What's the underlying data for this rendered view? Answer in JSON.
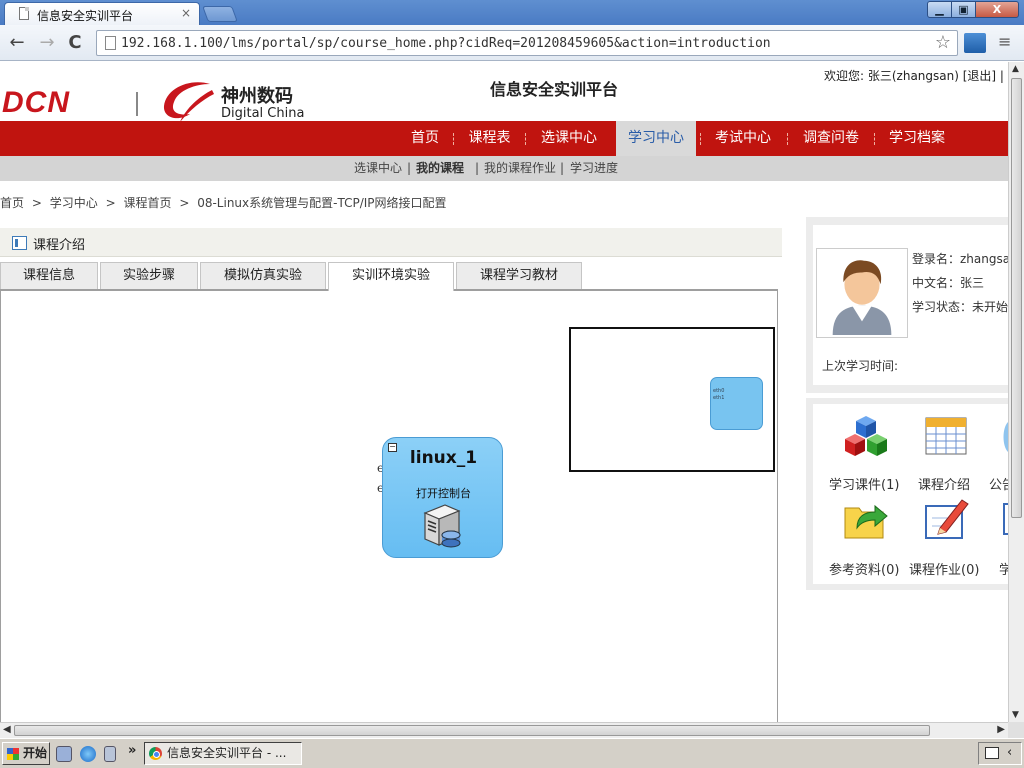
{
  "browser": {
    "tab_title": "信息安全实训平台",
    "tab_close": "×",
    "url": "192.168.1.100/lms/portal/sp/course_home.php?cidReq=201208459605&action=introduction",
    "back": "←",
    "forward": "→",
    "reload": "C",
    "star": "☆",
    "wrench": "≡",
    "win_min": "▁",
    "win_max": "▣",
    "win_close": "X"
  },
  "header": {
    "logo_dcn": "DCN",
    "logo_cn": "神州数码",
    "logo_en": "Digital China",
    "site_title": "信息安全实训平台",
    "welcome": "欢迎您: 张三(zhangsan) [退出] |"
  },
  "main_nav": {
    "items": [
      {
        "label": "首页",
        "active": false
      },
      {
        "label": "课程表",
        "active": false
      },
      {
        "label": "选课中心",
        "active": false
      },
      {
        "label": "学习中心",
        "active": true
      },
      {
        "label": "考试中心",
        "active": false
      },
      {
        "label": "调查问卷",
        "active": false
      },
      {
        "label": "学习档案",
        "active": false
      }
    ]
  },
  "sub_nav": {
    "items": [
      "选课中心",
      "|",
      "我的课程",
      "|",
      "我的课程作业",
      "|",
      "学习进度"
    ]
  },
  "breadcrumb": {
    "items": [
      "首页",
      ">",
      "学习中心",
      ">",
      "课程首页",
      ">",
      "08-Linux系统管理与配置-TCP/IP网络接口配置"
    ]
  },
  "course": {
    "panel_title": "课程介绍",
    "tabs": [
      {
        "label": "课程信息",
        "active": false
      },
      {
        "label": "实验步骤",
        "active": false
      },
      {
        "label": "模拟仿真实验",
        "active": false
      },
      {
        "label": "实训环境实验",
        "active": true
      },
      {
        "label": "课程学习教材",
        "active": false
      }
    ]
  },
  "topology": {
    "node_name": "linux_1",
    "node_action": "打开控制台",
    "ports": [
      "eth0",
      "eth1"
    ],
    "collapse_symbol": "−",
    "minimap_ports": [
      "eth0",
      "eth1"
    ]
  },
  "user": {
    "login_name": "登录名：zhangsa",
    "cn_name": "中文名：张三",
    "status": "学习状态：未开始",
    "last_time_label": "上次学习时间:"
  },
  "quick_links": [
    {
      "label": "学习课件(1)",
      "icon": "cubes-icon"
    },
    {
      "label": "课程介绍",
      "icon": "calendar-icon"
    },
    {
      "label": "公告",
      "icon": "megaphone-icon"
    },
    {
      "label": "参考资料(0)",
      "icon": "folder-arrow-icon"
    },
    {
      "label": "课程作业(0)",
      "icon": "pencil-edit-icon"
    },
    {
      "label": "学",
      "icon": "doc-icon"
    }
  ],
  "taskbar": {
    "start": "开始",
    "task_title": "信息安全实训平台 - ...",
    "more": "»"
  },
  "colors": {
    "nav_red": "#c0140f",
    "nav_active_bg": "#d9d9d9",
    "nav_active_text": "#2a5da8",
    "node_blue": "#66bdf2"
  }
}
